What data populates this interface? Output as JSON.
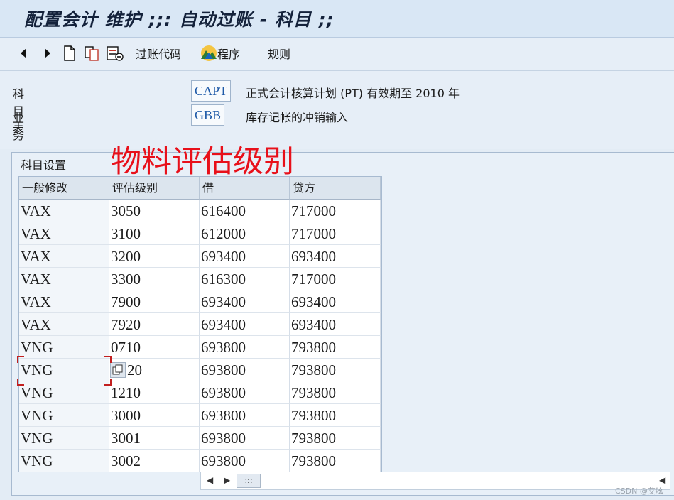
{
  "window": {
    "title": "配置会计 维护 ;;: 自动过账 - 科目 ;;"
  },
  "toolbar": {
    "posting_key_label": "过账代码",
    "procedures_label": "程序",
    "rules_label": "规则"
  },
  "fields": {
    "chart_of_accounts": {
      "label": "科目表",
      "value": "CAPT",
      "description": "正式会计核算计划 (PT) 有效期至 2010 年"
    },
    "transaction": {
      "label": "业务",
      "value": "GBB",
      "description": "库存记帐的冲销输入"
    }
  },
  "group": {
    "title": "科目设置"
  },
  "annotation": "物料评估级别",
  "table": {
    "columns": [
      "一般修改",
      "评估级别",
      "借",
      "贷方"
    ],
    "rows": [
      [
        "VAX",
        "3050",
        "616400",
        "717000"
      ],
      [
        "VAX",
        "3100",
        "612000",
        "717000"
      ],
      [
        "VAX",
        "3200",
        "693400",
        "693400"
      ],
      [
        "VAX",
        "3300",
        "616300",
        "717000"
      ],
      [
        "VAX",
        "7900",
        "693400",
        "693400"
      ],
      [
        "VAX",
        "7920",
        "693400",
        "693400"
      ],
      [
        "VNG",
        "0710",
        "693800",
        "793800"
      ],
      [
        "VNG",
        "20",
        "693800",
        "793800"
      ],
      [
        "VNG",
        "1210",
        "693800",
        "793800"
      ],
      [
        "VNG",
        "3000",
        "693800",
        "793800"
      ],
      [
        "VNG",
        "3001",
        "693800",
        "793800"
      ],
      [
        "VNG",
        "3002",
        "693800",
        "793800"
      ]
    ]
  },
  "scrollbar": {
    "thumb_label": ":::"
  },
  "watermark": "CSDN @艾吆"
}
